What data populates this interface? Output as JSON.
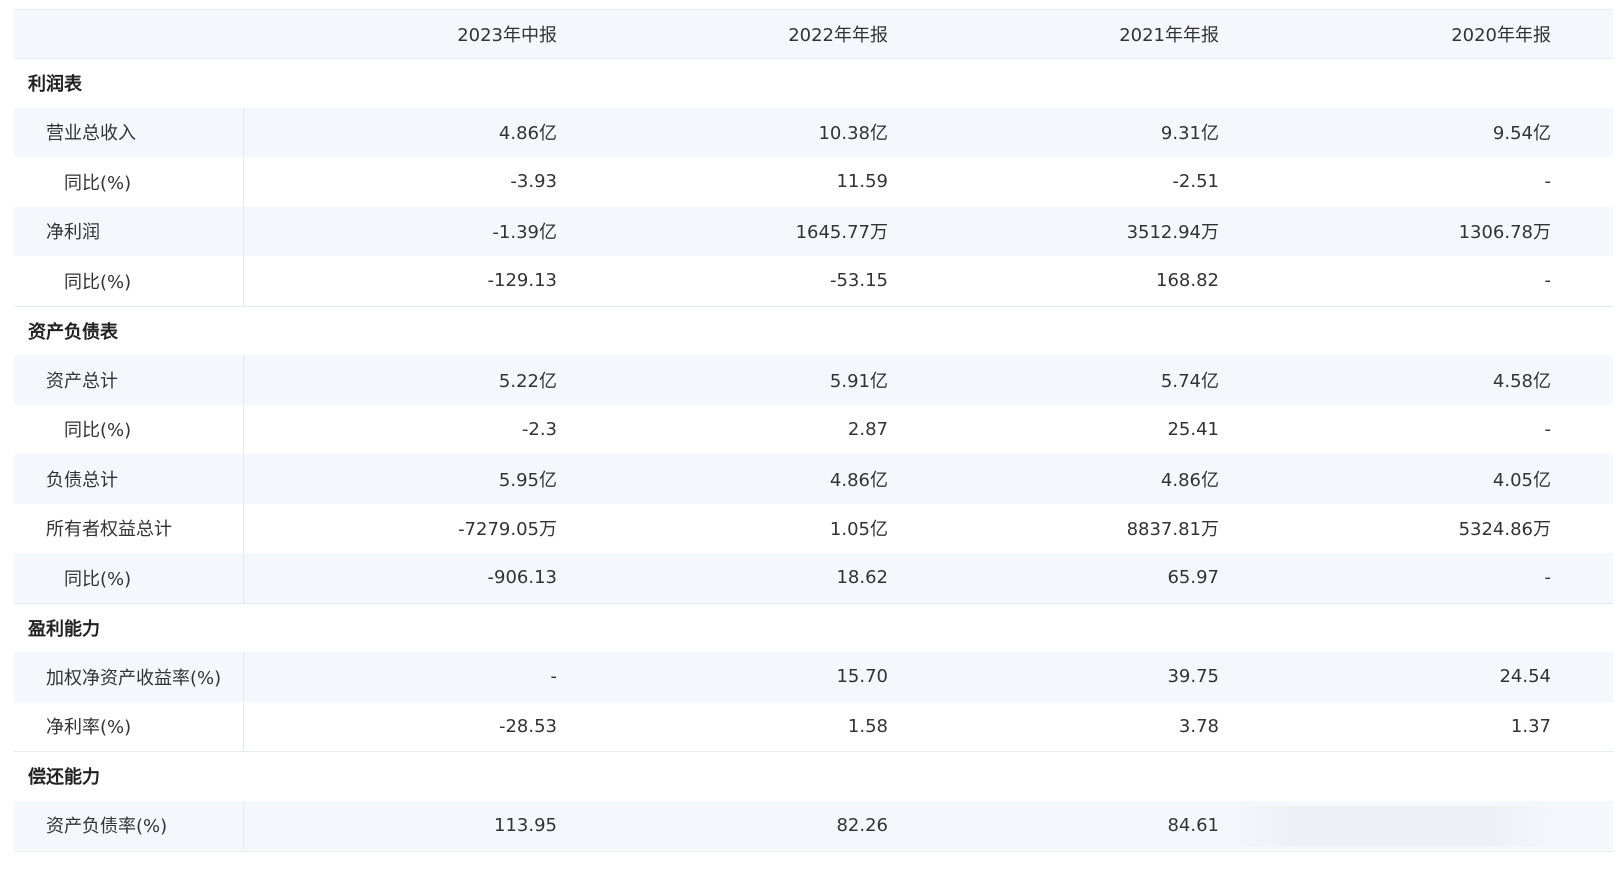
{
  "header": {
    "columns": [
      "2023年中报",
      "2022年年报",
      "2021年年报",
      "2020年年报"
    ]
  },
  "sections": [
    {
      "title": "利润表",
      "rows": [
        {
          "label": "营业总收入",
          "indent": 1,
          "values": [
            "4.86亿",
            "10.38亿",
            "9.31亿",
            "9.54亿"
          ]
        },
        {
          "label": "同比(%)",
          "indent": 2,
          "values": [
            "-3.93",
            "11.59",
            "-2.51",
            "-"
          ]
        },
        {
          "label": "净利润",
          "indent": 1,
          "values": [
            "-1.39亿",
            "1645.77万",
            "3512.94万",
            "1306.78万"
          ]
        },
        {
          "label": "同比(%)",
          "indent": 2,
          "values": [
            "-129.13",
            "-53.15",
            "168.82",
            "-"
          ]
        }
      ]
    },
    {
      "title": "资产负债表",
      "rows": [
        {
          "label": "资产总计",
          "indent": 1,
          "values": [
            "5.22亿",
            "5.91亿",
            "5.74亿",
            "4.58亿"
          ]
        },
        {
          "label": "同比(%)",
          "indent": 2,
          "values": [
            "-2.3",
            "2.87",
            "25.41",
            "-"
          ]
        },
        {
          "label": "负债总计",
          "indent": 1,
          "values": [
            "5.95亿",
            "4.86亿",
            "4.86亿",
            "4.05亿"
          ]
        },
        {
          "label": "所有者权益总计",
          "indent": 1,
          "values": [
            "-7279.05万",
            "1.05亿",
            "8837.81万",
            "5324.86万"
          ]
        },
        {
          "label": "同比(%)",
          "indent": 2,
          "values": [
            "-906.13",
            "18.62",
            "65.97",
            "-"
          ]
        }
      ]
    },
    {
      "title": "盈利能力",
      "rows": [
        {
          "label": "加权净资产收益率(%)",
          "indent": 1,
          "values": [
            "-",
            "15.70",
            "39.75",
            "24.54"
          ]
        },
        {
          "label": "净利率(%)",
          "indent": 1,
          "values": [
            "-28.53",
            "1.58",
            "3.78",
            "1.37"
          ]
        }
      ]
    },
    {
      "title": "偿还能力",
      "rows": [
        {
          "label": "资产负债率(%)",
          "indent": 1,
          "values": [
            "113.95",
            "82.26",
            "84.61",
            ""
          ]
        }
      ]
    }
  ]
}
